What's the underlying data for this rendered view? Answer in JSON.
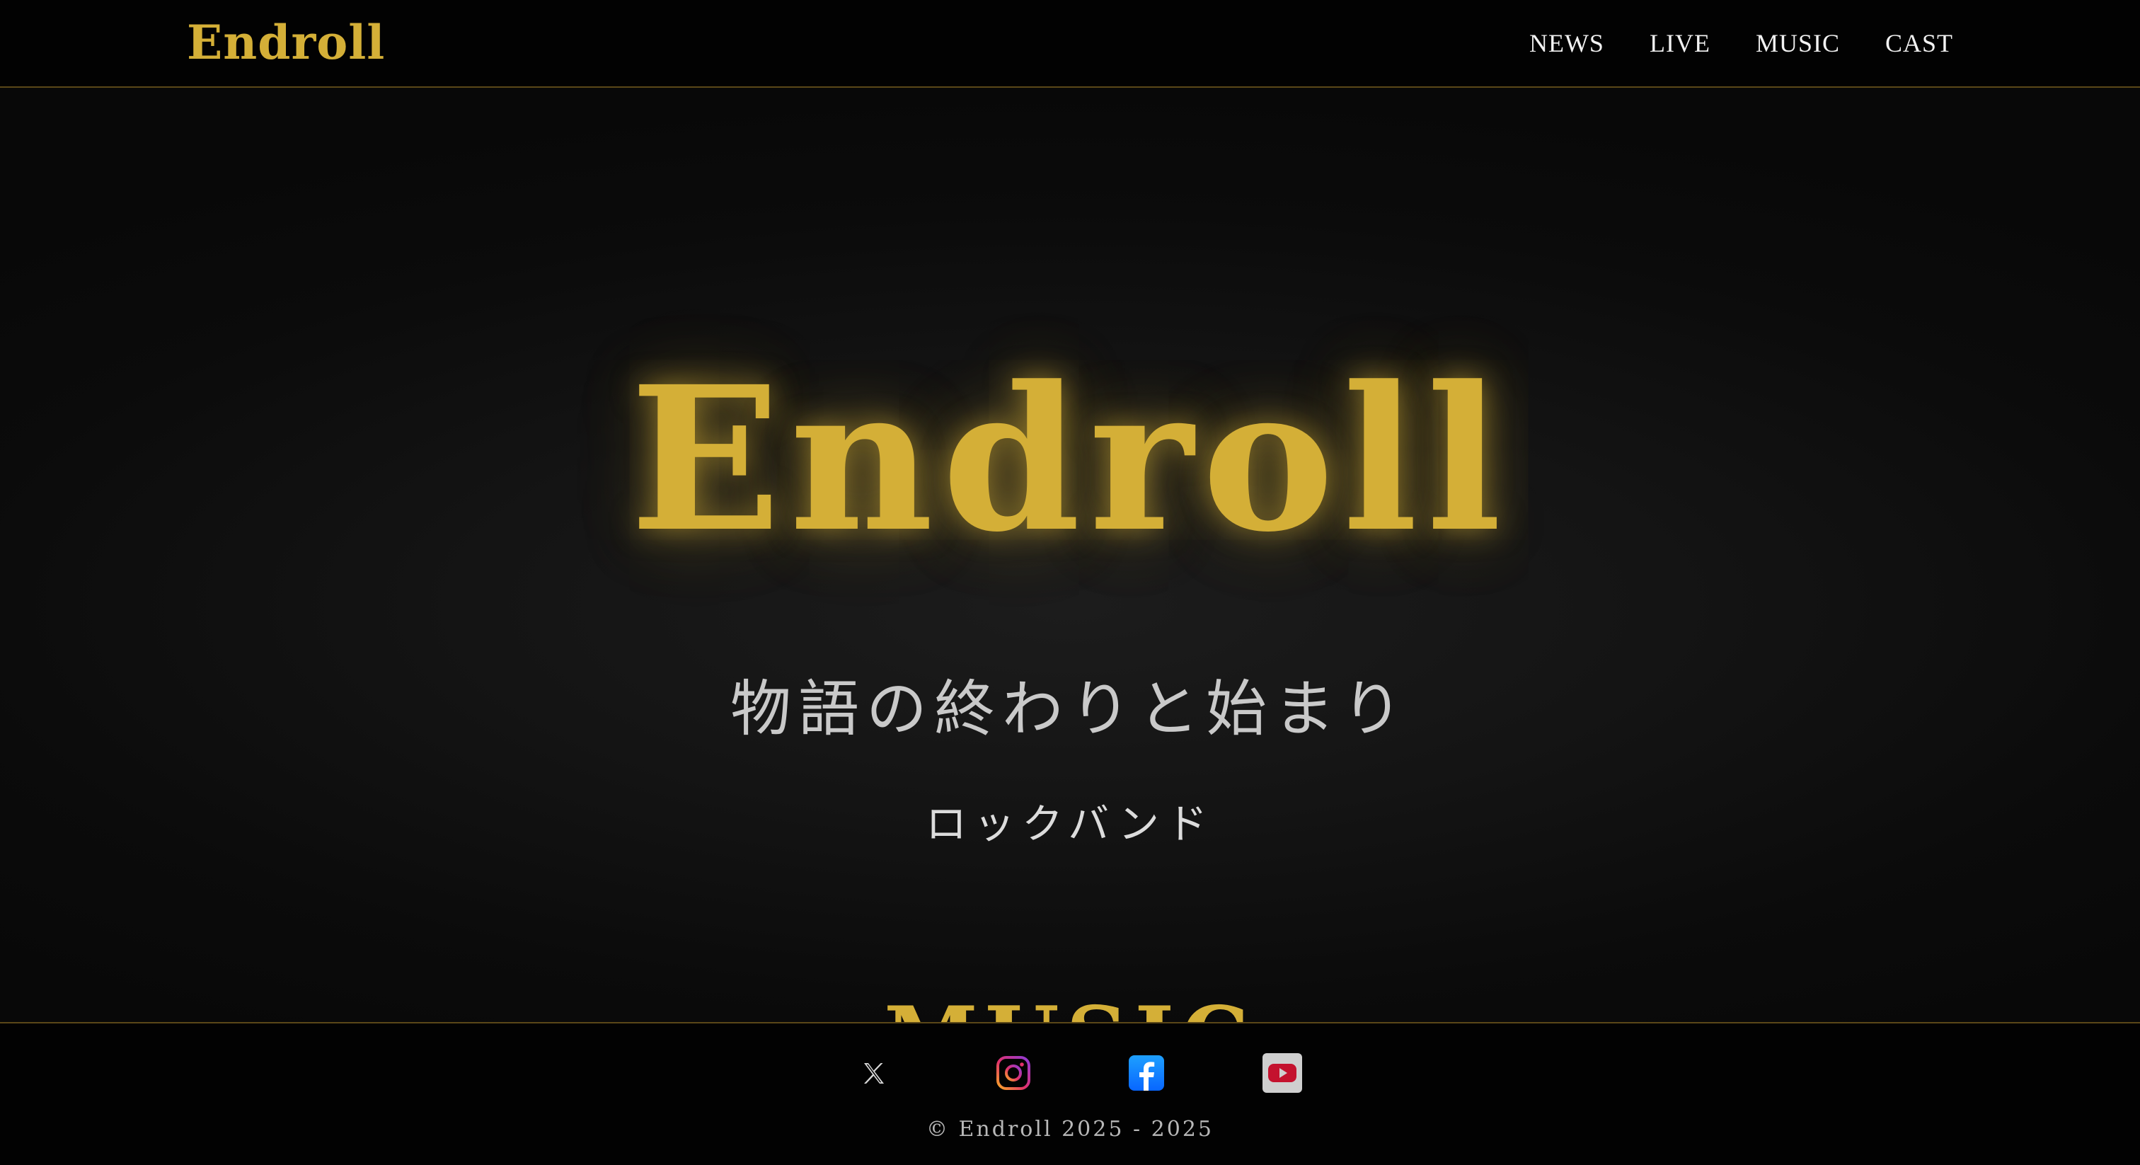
{
  "header": {
    "brand": "Endroll",
    "nav": [
      {
        "label": "NEWS"
      },
      {
        "label": "LIVE"
      },
      {
        "label": "MUSIC"
      },
      {
        "label": "CAST"
      }
    ]
  },
  "hero": {
    "title": "Endroll",
    "tagline": "物語の終わりと始まり",
    "genre": "ロックバンド"
  },
  "sections": {
    "music_heading": "MUSIC"
  },
  "footer": {
    "social": [
      {
        "icon": "x-icon"
      },
      {
        "icon": "instagram-icon"
      },
      {
        "icon": "facebook-icon"
      },
      {
        "icon": "youtube-icon"
      }
    ],
    "copyright": "© Endroll 2025 - 2025"
  },
  "colors": {
    "accent": "#d4af37",
    "background": "#0b0b0b",
    "header_bg": "#020202"
  }
}
